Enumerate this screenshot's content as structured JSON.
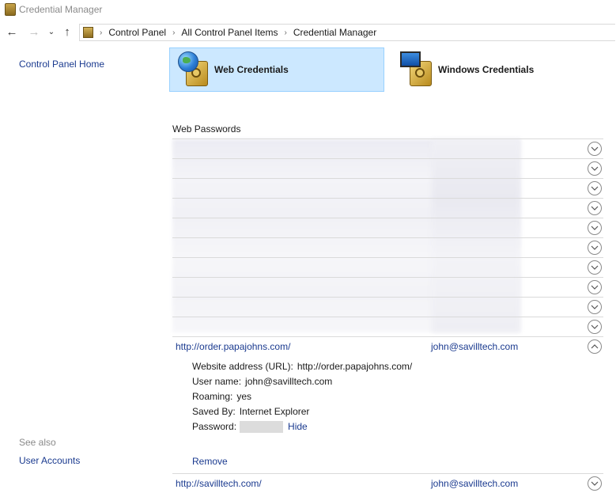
{
  "window": {
    "title": "Credential Manager"
  },
  "addressbar": {
    "breadcrumb": [
      "Control Panel",
      "All Control Panel Items",
      "Credential Manager"
    ]
  },
  "left_pane": {
    "home_link": "Control Panel Home",
    "see_also_label": "See also",
    "user_accounts_link": "User Accounts"
  },
  "tabs": {
    "web": "Web Credentials",
    "windows": "Windows Credentials"
  },
  "web_passwords": {
    "title": "Web Passwords",
    "expanded": {
      "site": "http://order.papajohns.com/",
      "user": "john@savilltech.com",
      "details": {
        "url_label": "Website address (URL):",
        "url_value": "http://order.papajohns.com/",
        "username_label": "User name:",
        "username_value": "john@savilltech.com",
        "roaming_label": "Roaming:",
        "roaming_value": "yes",
        "savedby_label": "Saved By:",
        "savedby_value": "Internet Explorer",
        "password_label": "Password:",
        "hide_link": "Hide",
        "remove_link": "Remove"
      }
    },
    "last_row": {
      "site": "http://savilltech.com/",
      "user": "john@savilltech.com"
    }
  }
}
